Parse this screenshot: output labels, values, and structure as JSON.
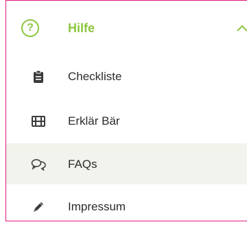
{
  "colors": {
    "accent_green": "#8cc63f",
    "frame_border": "#e0157e",
    "active_bg": "#f1f3ec",
    "text": "#2b2b2b"
  },
  "menu": {
    "header": {
      "icon": "question-circle-icon",
      "label": "Hilfe",
      "expanded": true,
      "toggle_icon": "chevron-up-icon"
    },
    "items": [
      {
        "label": "Checkliste",
        "icon": "clipboard-icon",
        "active": false
      },
      {
        "label": "Erklär Bär",
        "icon": "film-icon",
        "active": false
      },
      {
        "label": "FAQs",
        "icon": "chat-bubbles-icon",
        "active": true
      },
      {
        "label": "Impressum",
        "icon": "pen-icon",
        "active": false
      }
    ]
  }
}
